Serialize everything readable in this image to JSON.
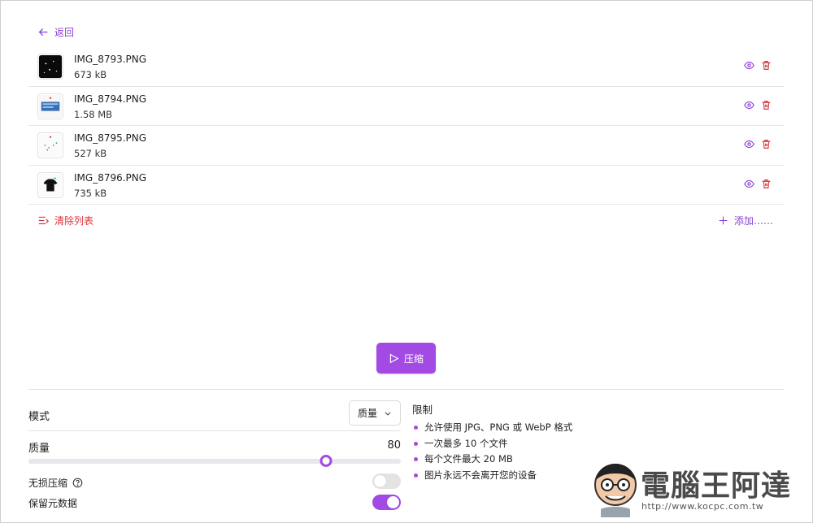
{
  "nav": {
    "back_label": "返回"
  },
  "files": [
    {
      "name": "IMG_8793.PNG",
      "size": "673 kB"
    },
    {
      "name": "IMG_8794.PNG",
      "size": "1.58 MB"
    },
    {
      "name": "IMG_8795.PNG",
      "size": "527 kB"
    },
    {
      "name": "IMG_8796.PNG",
      "size": "735 kB"
    }
  ],
  "list_actions": {
    "clear_label": "清除列表",
    "add_label": "添加……"
  },
  "compress": {
    "label": "压缩"
  },
  "settings": {
    "mode_label": "模式",
    "mode_value": "质量",
    "quality_label": "质量",
    "quality_value": "80",
    "quality_percent": 80,
    "lossless_label": "无损压缩",
    "lossless_on": false,
    "keep_metadata_label": "保留元数据",
    "keep_metadata_on": true
  },
  "limits": {
    "title": "限制",
    "items": [
      "允许使用 JPG、PNG 或 WebP 格式",
      "一次最多 10 个文件",
      "每个文件最大 20 MB",
      "图片永远不会离开您的设备"
    ]
  },
  "watermark": {
    "text": "電腦王阿達",
    "url": "http://www.kocpc.com.tw"
  },
  "colors": {
    "accent": "#a34ae5",
    "danger": "#d8343a",
    "link": "#8b3fd9"
  },
  "icons": {
    "back": "arrow-left-icon",
    "preview": "eye-icon",
    "delete": "trash-icon",
    "clear": "clear-list-icon",
    "add": "plus-icon",
    "compress": "play-icon",
    "dropdown": "chevron-down-icon",
    "help": "help-circle-icon"
  }
}
